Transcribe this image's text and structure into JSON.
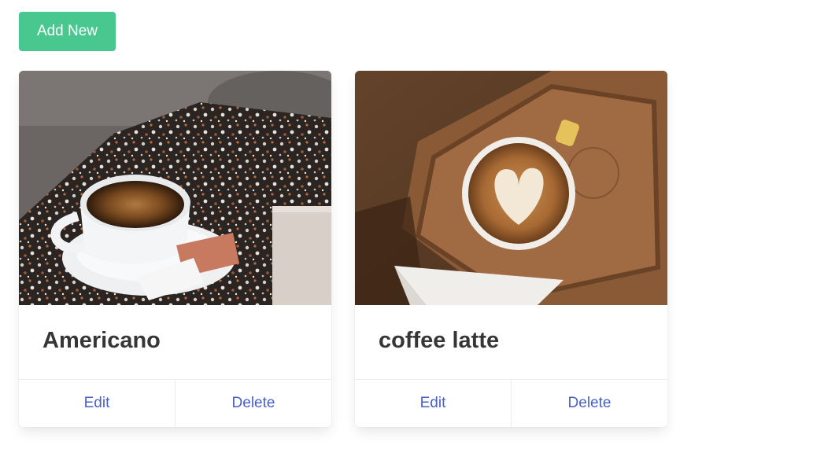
{
  "toolbar": {
    "add_label": "Add New"
  },
  "cards": [
    {
      "title": "Americano",
      "image_subject": "americano-photo",
      "edit_label": "Edit",
      "delete_label": "Delete"
    },
    {
      "title": "coffee latte",
      "image_subject": "latte-photo",
      "edit_label": "Edit",
      "delete_label": "Delete"
    }
  ],
  "colors": {
    "primary_button": "#48c78e",
    "link": "#485fc7",
    "title_text": "#363636",
    "divider": "#ededed"
  }
}
